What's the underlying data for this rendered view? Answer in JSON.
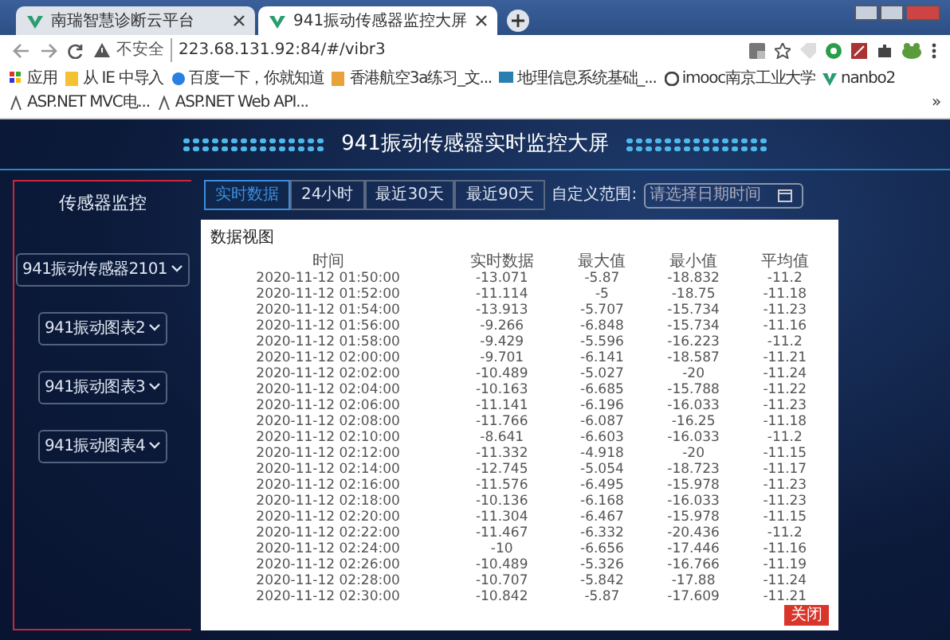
{
  "browser": {
    "tabs": [
      {
        "title": "南瑞智慧诊断云平台",
        "selected": false
      },
      {
        "title": "941振动传感器监控大屏",
        "selected": true
      }
    ],
    "security": "不安全",
    "url": "223.68.131.92:84/#/vibr3",
    "bookmarks": [
      "应用",
      "从 IE 中导入",
      "百度一下，你就知道",
      "香港航空3a练习_文...",
      "地理信息系统基础_...",
      "imooc南京工业大学",
      "nanbo2",
      "ASP.NET MVC电...",
      "ASP.NET Web API..."
    ],
    "bookmarks_more": "»"
  },
  "page": {
    "title": "941振动传感器实时监控大屏",
    "sidebar": {
      "title": "传感器监控",
      "items": [
        "941振动传感器2101",
        "941振动图表2",
        "941振动图表3",
        "941振动图表4"
      ]
    },
    "ranges": [
      {
        "label": "实时数据",
        "selected": true
      },
      {
        "label": "24小时",
        "selected": false
      },
      {
        "label": "最近30天",
        "selected": false
      },
      {
        "label": "最近90天",
        "selected": false
      }
    ],
    "custom_label": "自定义范围:",
    "date_field": {
      "placeholder": "请选择日期时间"
    },
    "data_view": {
      "title": "数据视图",
      "columns": [
        "时间",
        "实时数据",
        "最大值",
        "最小值",
        "平均值"
      ],
      "rows": [
        [
          "2020-11-12 01:50:00",
          "-13.071",
          "-5.87",
          "-18.832",
          "-11.2"
        ],
        [
          "2020-11-12 01:52:00",
          "-11.114",
          "-5",
          "-18.75",
          "-11.18"
        ],
        [
          "2020-11-12 01:54:00",
          "-13.913",
          "-5.707",
          "-15.734",
          "-11.23"
        ],
        [
          "2020-11-12 01:56:00",
          "-9.266",
          "-6.848",
          "-15.734",
          "-11.16"
        ],
        [
          "2020-11-12 01:58:00",
          "-9.429",
          "-5.596",
          "-16.223",
          "-11.2"
        ],
        [
          "2020-11-12 02:00:00",
          "-9.701",
          "-6.141",
          "-18.587",
          "-11.21"
        ],
        [
          "2020-11-12 02:02:00",
          "-10.489",
          "-5.027",
          "-20",
          "-11.24"
        ],
        [
          "2020-11-12 02:04:00",
          "-10.163",
          "-6.685",
          "-15.788",
          "-11.22"
        ],
        [
          "2020-11-12 02:06:00",
          "-11.141",
          "-6.196",
          "-16.033",
          "-11.23"
        ],
        [
          "2020-11-12 02:08:00",
          "-11.766",
          "-6.087",
          "-16.25",
          "-11.18"
        ],
        [
          "2020-11-12 02:10:00",
          "-8.641",
          "-6.603",
          "-16.033",
          "-11.2"
        ],
        [
          "2020-11-12 02:12:00",
          "-11.332",
          "-4.918",
          "-20",
          "-11.15"
        ],
        [
          "2020-11-12 02:14:00",
          "-12.745",
          "-5.054",
          "-18.723",
          "-11.17"
        ],
        [
          "2020-11-12 02:16:00",
          "-11.576",
          "-6.495",
          "-15.978",
          "-11.23"
        ],
        [
          "2020-11-12 02:18:00",
          "-10.136",
          "-6.168",
          "-16.033",
          "-11.23"
        ],
        [
          "2020-11-12 02:20:00",
          "-11.304",
          "-6.467",
          "-15.978",
          "-11.15"
        ],
        [
          "2020-11-12 02:22:00",
          "-11.467",
          "-6.332",
          "-20.436",
          "-11.2"
        ],
        [
          "2020-11-12 02:24:00",
          "-10",
          "-6.656",
          "-17.446",
          "-11.16"
        ],
        [
          "2020-11-12 02:26:00",
          "-10.489",
          "-5.326",
          "-16.766",
          "-11.19"
        ],
        [
          "2020-11-12 02:28:00",
          "-10.707",
          "-5.842",
          "-17.88",
          "-11.24"
        ],
        [
          "2020-11-12 02:30:00",
          "-10.842",
          "-5.87",
          "-17.609",
          "-11.21"
        ]
      ],
      "close": "关闭"
    }
  }
}
